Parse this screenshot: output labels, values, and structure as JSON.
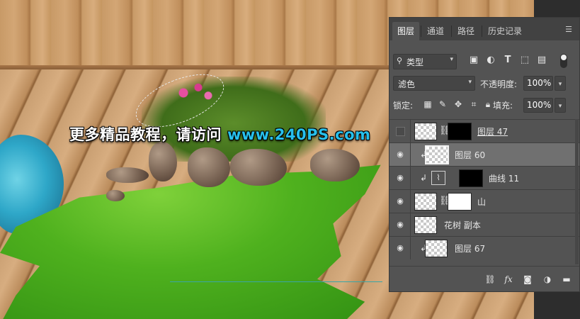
{
  "watermark": {
    "text_cn": "更多精品教程，请访问",
    "url": "www.240PS.com"
  },
  "panel": {
    "tabs": [
      {
        "label": "图层",
        "active": true
      },
      {
        "label": "通道",
        "active": false
      },
      {
        "label": "路径",
        "active": false
      },
      {
        "label": "历史记录",
        "active": false
      }
    ],
    "menu_icon": "panel-menu-icon",
    "filter": {
      "kind_label": "类型",
      "icons": [
        "pixel-filter-icon",
        "adjustment-filter-icon",
        "type-filter-icon",
        "shape-filter-icon",
        "smart-object-filter-icon"
      ]
    },
    "blend_mode": "滤色",
    "opacity_label": "不透明度:",
    "opacity_value": "100%",
    "lock_label": "锁定:",
    "fill_label": "填充:",
    "fill_value": "100%",
    "layers": [
      {
        "name": "图层 47",
        "visible": false,
        "clipped": false,
        "mask": "black",
        "linked": true
      },
      {
        "name": "图层 60",
        "visible": true,
        "clipped": true,
        "selected": true
      },
      {
        "name": "曲线 11",
        "visible": true,
        "clipped": true,
        "adjustment": "curves",
        "mask": "black"
      },
      {
        "name": "山",
        "visible": true,
        "clipped": false,
        "mask": "white",
        "linked": true
      },
      {
        "name": "花树 副本",
        "visible": true,
        "clipped": false
      },
      {
        "name": "图层 67",
        "visible": true,
        "clipped": true
      }
    ],
    "bottom_icons": [
      "link-layers-icon",
      "fx-icon",
      "add-mask-icon",
      "adjustment-layer-icon",
      "new-group-icon"
    ],
    "fx_label": "fx"
  },
  "colors": {
    "panel_bg": "#535353",
    "selected_row": "#707070",
    "watermark_url": "#27c0ec"
  }
}
